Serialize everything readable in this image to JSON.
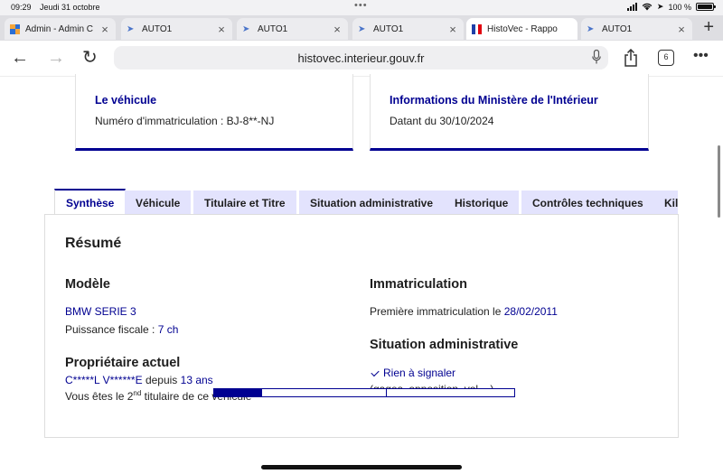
{
  "status_bar": {
    "time": "09:29",
    "date": "Jeudi 31 octobre",
    "battery": "100 %"
  },
  "browser": {
    "tabs": [
      {
        "label": "Admin - Admin C",
        "favicon": "admin-favicon",
        "active": false
      },
      {
        "label": "AUTO1",
        "favicon": "auto1-favicon",
        "active": false
      },
      {
        "label": "AUTO1",
        "favicon": "auto1-favicon",
        "active": false
      },
      {
        "label": "AUTO1",
        "favicon": "auto1-favicon",
        "active": false
      },
      {
        "label": "HistoVec - Rappo",
        "favicon": "french-flag-favicon",
        "active": true
      },
      {
        "label": "AUTO1",
        "favicon": "auto1-favicon",
        "active": false
      }
    ],
    "url": "histovec.interieur.gouv.fr",
    "tab_count": "6",
    "colors": {
      "tabbar": "#dedee2",
      "active_tab": "#ffffff"
    }
  },
  "cards": {
    "vehicle": {
      "title": "Le véhicule",
      "text": "Numéro d'immatriculation : BJ-8**-NJ"
    },
    "ministry": {
      "title": "Informations du Ministère de l'Intérieur",
      "text": "Datant du 30/10/2024"
    }
  },
  "nav_tabs": [
    {
      "label": "Synthèse",
      "active": true
    },
    {
      "label": "Véhicule",
      "active": false
    },
    {
      "label": "Titulaire et Titre",
      "active": false
    },
    {
      "label": "Situation administrative",
      "active": false
    },
    {
      "label": "Historique",
      "active": false
    },
    {
      "label": "Contrôles techniques",
      "active": false
    },
    {
      "label": "Kilo",
      "active": false
    }
  ],
  "summary": {
    "title": "Résumé",
    "model": {
      "heading": "Modèle",
      "name": "BMW SERIE 3",
      "power_label": "Puissance fiscale : ",
      "power_value": "7 ch"
    },
    "owner": {
      "heading": "Propriétaire actuel",
      "name": "C*****L V******E",
      "since_label": " depuis ",
      "since_value": "13 ans",
      "rank_prefix": "Vous êtes le 2",
      "rank_sup": "nd",
      "rank_suffix": " titulaire de ce véhicule"
    },
    "registration": {
      "heading": "Immatriculation",
      "first_label": "Première immatriculation le ",
      "first_date": "28/02/2011"
    },
    "admin_status": {
      "heading": "Situation administrative",
      "status": "Rien à signaler",
      "detail": "(gages, opposition, vol,...)"
    }
  },
  "theme": {
    "primary": "#000091",
    "tab_bg": "#e3e3fd"
  }
}
